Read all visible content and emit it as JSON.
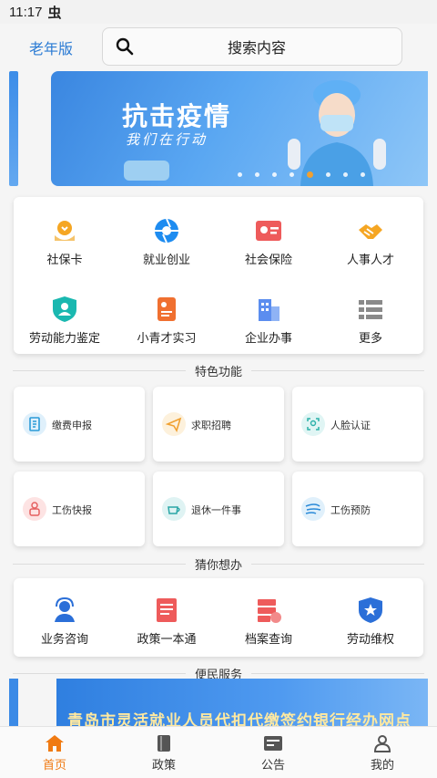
{
  "status": {
    "time": "11:17",
    "bug_icon": "虫"
  },
  "header": {
    "elder_mode": "老年版",
    "search_placeholder": "搜索内容"
  },
  "banner": {
    "title": "抗击疫情",
    "subtitle": "我们在行动"
  },
  "services": [
    {
      "label": "社保卡",
      "icon": "hands-heart-icon",
      "color": "#f5a623"
    },
    {
      "label": "就业创业",
      "icon": "aperture-icon",
      "color": "#1e8cf0"
    },
    {
      "label": "社会保险",
      "icon": "id-card-icon",
      "color": "#ee5b5b"
    },
    {
      "label": "人事人才",
      "icon": "handshake-icon",
      "color": "#f5a623"
    },
    {
      "label": "劳动能力鉴定",
      "icon": "shield-person-icon",
      "color": "#1ab8b0"
    },
    {
      "label": "小青才实习",
      "icon": "resume-icon",
      "color": "#f07030"
    },
    {
      "label": "企业办事",
      "icon": "building-icon",
      "color": "#5b8def"
    },
    {
      "label": "更多",
      "icon": "list-icon",
      "color": "#8a8a8a"
    }
  ],
  "sections": {
    "featured": "特色功能",
    "guess": "猜你想办",
    "convenience": "便民服务"
  },
  "features": [
    {
      "label": "缴费申报",
      "icon": "bill-icon",
      "bg": "#dff0fb",
      "color": "#2a9ad8"
    },
    {
      "label": "求职招聘",
      "icon": "paper-plane-icon",
      "bg": "#fdf1dc",
      "color": "#f0a030"
    },
    {
      "label": "人脸认证",
      "icon": "face-scan-icon",
      "bg": "#e0f5f4",
      "color": "#2ab0a8"
    },
    {
      "label": "工伤快报",
      "icon": "injury-icon",
      "bg": "#fde3e3",
      "color": "#e56060"
    },
    {
      "label": "退休一件事",
      "icon": "tea-cup-icon",
      "bg": "#dff3f3",
      "color": "#2aa6a6"
    },
    {
      "label": "工伤预防",
      "icon": "wind-icon",
      "bg": "#e0f0fb",
      "color": "#2a8ad8"
    }
  ],
  "guess": [
    {
      "label": "业务咨询",
      "icon": "headset-agent-icon",
      "color": "#2b6fd8"
    },
    {
      "label": "政策一本通",
      "icon": "book-icon",
      "color": "#ee5b5b"
    },
    {
      "label": "档案查询",
      "icon": "archive-icon",
      "color": "#ee5b5b"
    },
    {
      "label": "劳动维权",
      "icon": "shield-badge-icon",
      "color": "#2b6fd8"
    }
  ],
  "convenience_banner": "青岛市灵活就业人员代扣代缴签约银行经办网点",
  "tabs": [
    {
      "label": "首页",
      "icon": "home-icon",
      "active": true
    },
    {
      "label": "政策",
      "icon": "book-tab-icon",
      "active": false
    },
    {
      "label": "公告",
      "icon": "notice-icon",
      "active": false
    },
    {
      "label": "我的",
      "icon": "user-icon",
      "active": false
    }
  ],
  "accent": "#f07a12"
}
